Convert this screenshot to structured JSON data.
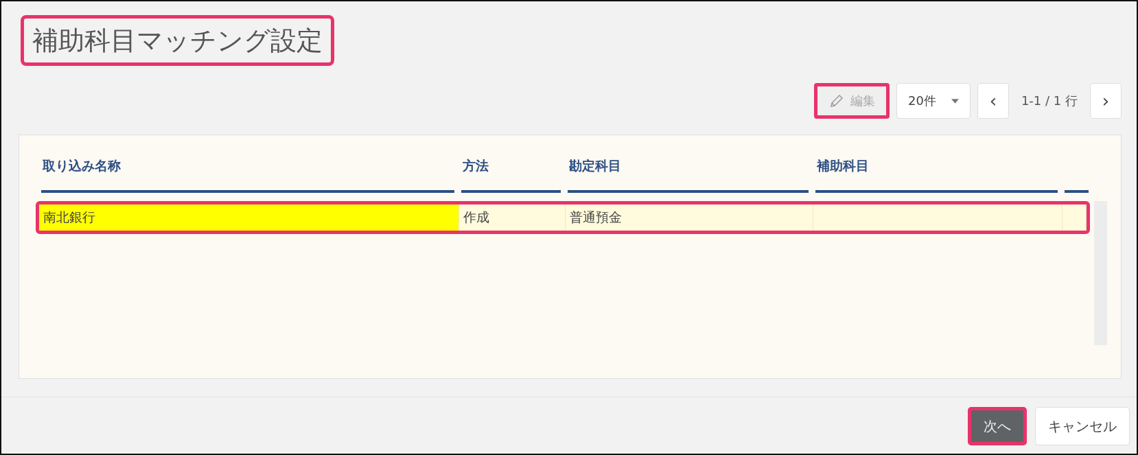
{
  "title": {
    "text": "補助科目マッチング設定",
    "highlighted": true
  },
  "toolbar": {
    "edit_button": {
      "label": "編集",
      "disabled": true,
      "highlighted": true
    },
    "page_size": "20件",
    "prev": "‹",
    "range": "1-1 / 1 行",
    "next": "›"
  },
  "table": {
    "columns": [
      "取り込み名称",
      "方法",
      "勘定科目",
      "補助科目"
    ],
    "rows": [
      {
        "highlighted": true,
        "cells": [
          {
            "text": "南北銀行",
            "marked": true
          },
          {
            "text": "作成",
            "marked": false
          },
          {
            "text": "普通預金",
            "marked": false
          },
          {
            "text": "",
            "marked": false
          }
        ]
      }
    ]
  },
  "buttons": [
    {
      "label": "次へ",
      "kind": "primary",
      "highlighted": true
    },
    {
      "label": "キャンセル",
      "kind": "secondary",
      "highlighted": false
    }
  ]
}
